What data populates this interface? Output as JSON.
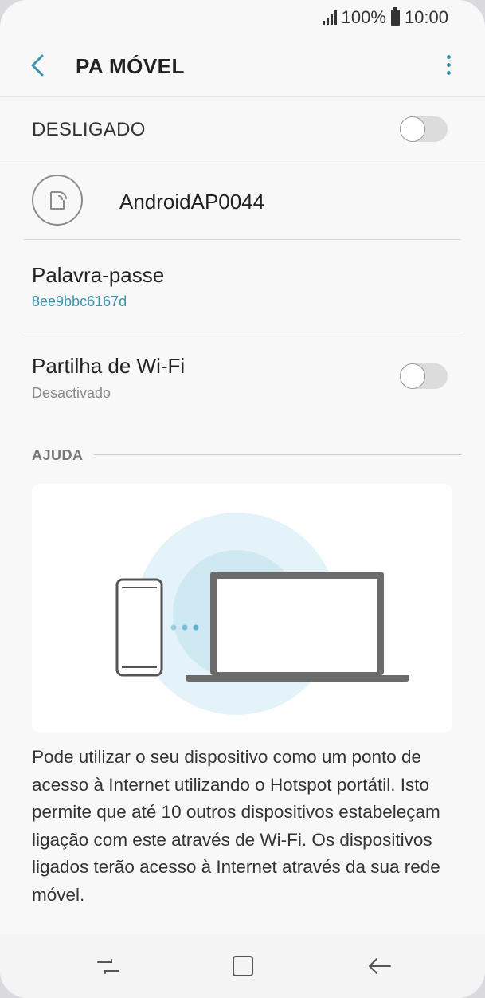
{
  "status": {
    "battery": "100%",
    "time": "10:00"
  },
  "appbar": {
    "title": "PA MÓVEL"
  },
  "master": {
    "label": "DESLIGADO",
    "enabled": false
  },
  "network": {
    "ssid": "AndroidAP0044"
  },
  "password": {
    "title": "Palavra-passe",
    "value": "8ee9bbc6167d"
  },
  "wifi_sharing": {
    "title": "Partilha de Wi-Fi",
    "status": "Desactivado",
    "enabled": false
  },
  "help": {
    "label": "AJUDA",
    "text": "Pode utilizar o seu dispositivo como um ponto de acesso à Internet utilizando o Hotspot portátil. Isto permite que até 10 outros dispositivos estabeleçam ligação com este através de Wi-Fi. Os dispositivos ligados terão acesso à Internet através da sua rede móvel."
  },
  "colors": {
    "accent": "#3c93b0",
    "toggle_off": "#dcdcdc",
    "background": "#f8f8f8",
    "illustration_glow": "#d6eef6"
  },
  "icons": {
    "back": "chevron-left-icon",
    "more": "more-vertical-icon",
    "hotspot": "phone-hotspot-icon",
    "nav_recents": "recents-icon",
    "nav_home": "home-icon",
    "nav_back": "back-arrow-icon"
  }
}
